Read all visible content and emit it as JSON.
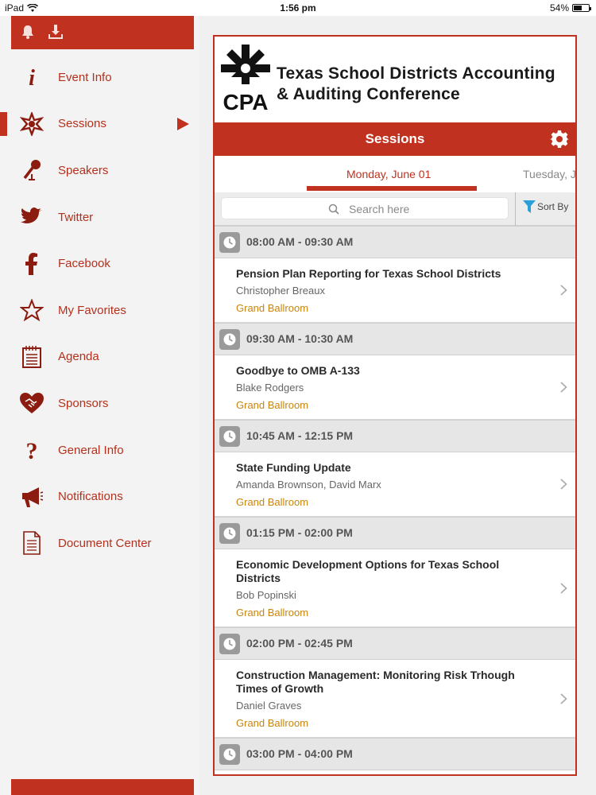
{
  "status_bar": {
    "device": "iPad",
    "time": "1:56 pm",
    "battery": "54%",
    "battery_level": 0.54
  },
  "sidebar": {
    "items": [
      {
        "label": "Event Info",
        "icon": "info-icon"
      },
      {
        "label": "Sessions",
        "icon": "sessions-icon",
        "active": true
      },
      {
        "label": "Speakers",
        "icon": "microphone-icon"
      },
      {
        "label": "Twitter",
        "icon": "twitter-icon"
      },
      {
        "label": "Facebook",
        "icon": "facebook-icon"
      },
      {
        "label": "My Favorites",
        "icon": "star-icon"
      },
      {
        "label": "Agenda",
        "icon": "agenda-icon"
      },
      {
        "label": "Sponsors",
        "icon": "handshake-icon"
      },
      {
        "label": "General Info",
        "icon": "question-icon"
      },
      {
        "label": "Notifications",
        "icon": "megaphone-icon"
      },
      {
        "label": "Document Center",
        "icon": "document-icon"
      }
    ]
  },
  "banner": {
    "logo_text": "CPA",
    "title_line1": "Texas School Districts Accounting",
    "title_line2": "& Auditing Conference"
  },
  "header": {
    "title": "Sessions"
  },
  "days": {
    "selected": "Monday, June 01",
    "next": "Tuesday, J"
  },
  "search": {
    "placeholder": "Search here"
  },
  "sort": {
    "label": "Sort By"
  },
  "schedule": [
    {
      "time": "08:00 AM - 09:30 AM",
      "sessions": [
        {
          "title": "Pension Plan Reporting for Texas School Districts",
          "speakers": "Christopher Breaux",
          "room": "Grand Ballroom"
        }
      ]
    },
    {
      "time": "09:30 AM - 10:30 AM",
      "sessions": [
        {
          "title": "Goodbye to OMB A-133",
          "speakers": "Blake Rodgers",
          "room": "Grand Ballroom"
        }
      ]
    },
    {
      "time": "10:45 AM - 12:15 PM",
      "sessions": [
        {
          "title": "State Funding Update",
          "speakers": "Amanda Brownson, David Marx",
          "room": "Grand Ballroom"
        }
      ]
    },
    {
      "time": "01:15 PM - 02:00 PM",
      "sessions": [
        {
          "title": "Economic Development Options for Texas School Districts",
          "speakers": "Bob Popinski",
          "room": "Grand Ballroom"
        }
      ]
    },
    {
      "time": "02:00 PM - 02:45 PM",
      "sessions": [
        {
          "title": "Construction Management: Monitoring Risk Trhough Times of Growth",
          "speakers": "Daniel Graves",
          "room": "Grand Ballroom"
        }
      ]
    },
    {
      "time": "03:00 PM - 04:00 PM",
      "sessions": []
    }
  ],
  "colors": {
    "accent": "#c0311f",
    "room": "#c9850e",
    "sidebar_bg": "#f3f3f3"
  }
}
